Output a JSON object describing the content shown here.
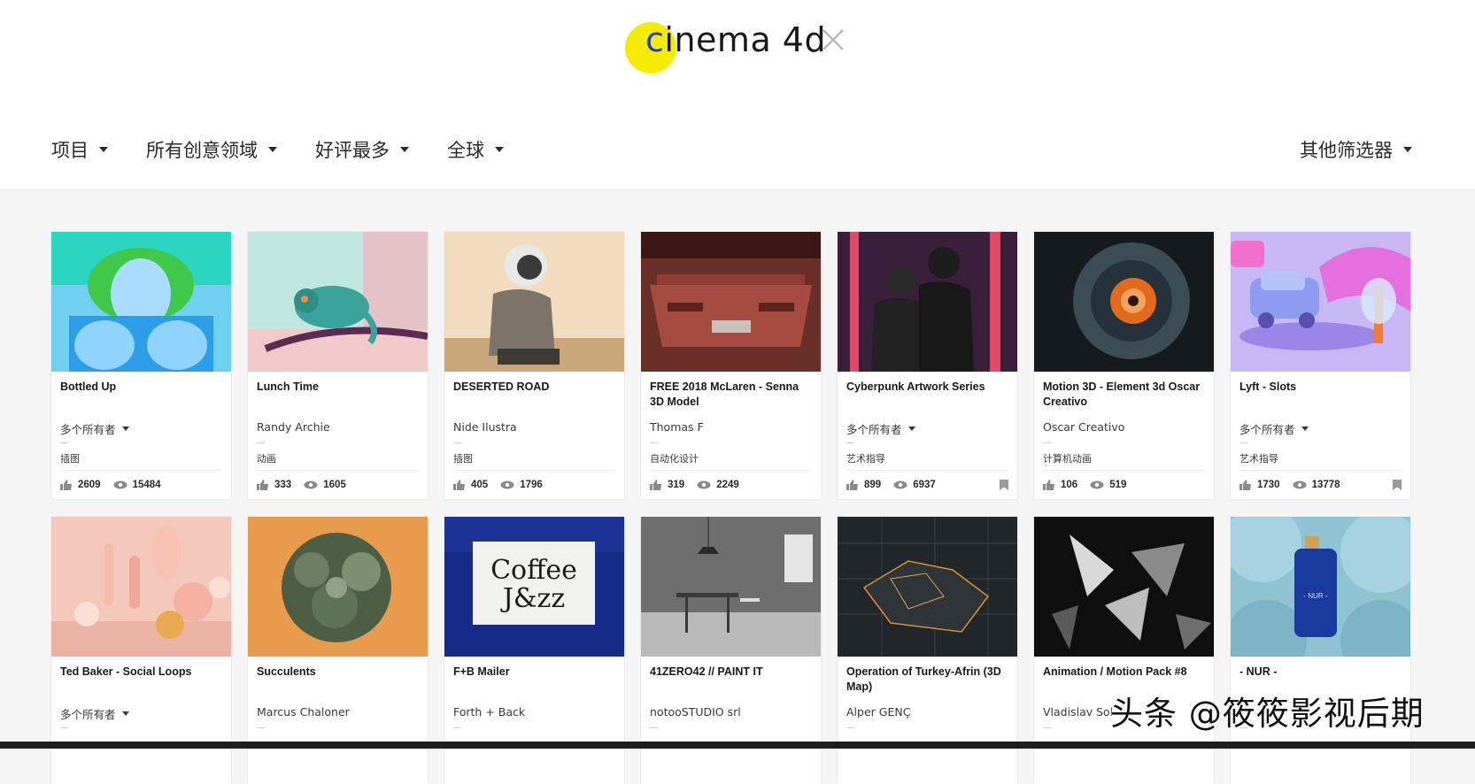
{
  "search": {
    "query_first": "c",
    "query_rest": "inema 4d"
  },
  "filters": {
    "type": "项目",
    "field": "所有创意领域",
    "sort": "好评最多",
    "region": "全球",
    "more": "其他筛选器"
  },
  "cards": [
    {
      "title": "Bottled Up",
      "owner": "多个所有者",
      "multi": true,
      "field": "插图",
      "likes": "2609",
      "views": "15484",
      "bookmark": false
    },
    {
      "title": "Lunch Time",
      "owner": "Randy Archie",
      "multi": false,
      "field": "动画",
      "likes": "333",
      "views": "1605",
      "bookmark": false
    },
    {
      "title": "DESERTED ROAD",
      "owner": "Nide Ilustra",
      "multi": false,
      "field": "插图",
      "likes": "405",
      "views": "1796",
      "bookmark": false
    },
    {
      "title": "FREE 2018 McLaren - Senna 3D Model",
      "owner": "Thomas F",
      "multi": false,
      "field": "自动化设计",
      "likes": "319",
      "views": "2249",
      "bookmark": false
    },
    {
      "title": "Cyberpunk Artwork Series",
      "owner": "多个所有者",
      "multi": true,
      "field": "艺术指导",
      "likes": "899",
      "views": "6937",
      "bookmark": true
    },
    {
      "title": "Motion 3D - Element 3d Oscar Creativo",
      "owner": "Oscar Creativo",
      "multi": false,
      "field": "计算机动画",
      "likes": "106",
      "views": "519",
      "bookmark": false
    },
    {
      "title": "Lyft - Slots",
      "owner": "多个所有者",
      "multi": true,
      "field": "艺术指导",
      "likes": "1730",
      "views": "13778",
      "bookmark": true
    },
    {
      "title": "Ted Baker - Social Loops",
      "owner": "多个所有者",
      "multi": true
    },
    {
      "title": "Succulents",
      "owner": "Marcus Chaloner",
      "multi": false
    },
    {
      "title": "F+B Mailer",
      "owner": "Forth + Back",
      "multi": false
    },
    {
      "title": "41ZERO42 // PAINT IT",
      "owner": "notooSTUDIO srl",
      "multi": false
    },
    {
      "title": "Operation of Turkey-Afrin (3D Map)",
      "owner": "Alper GENÇ",
      "multi": false
    },
    {
      "title": "Animation / Motion Pack #8",
      "owner": "Vladislav Sol",
      "multi": false
    },
    {
      "title": "- NUR -",
      "owner": "",
      "multi": false
    }
  ],
  "thumb_text": {
    "coffee_line1": "Coffee",
    "coffee_line2": "J&zz",
    "nur_label": "- NUR -"
  },
  "watermark": "头条 @筱筱影视后期",
  "colors": {
    "accent": "#1b3ad6",
    "cursor_highlight": "#f5ec00"
  }
}
